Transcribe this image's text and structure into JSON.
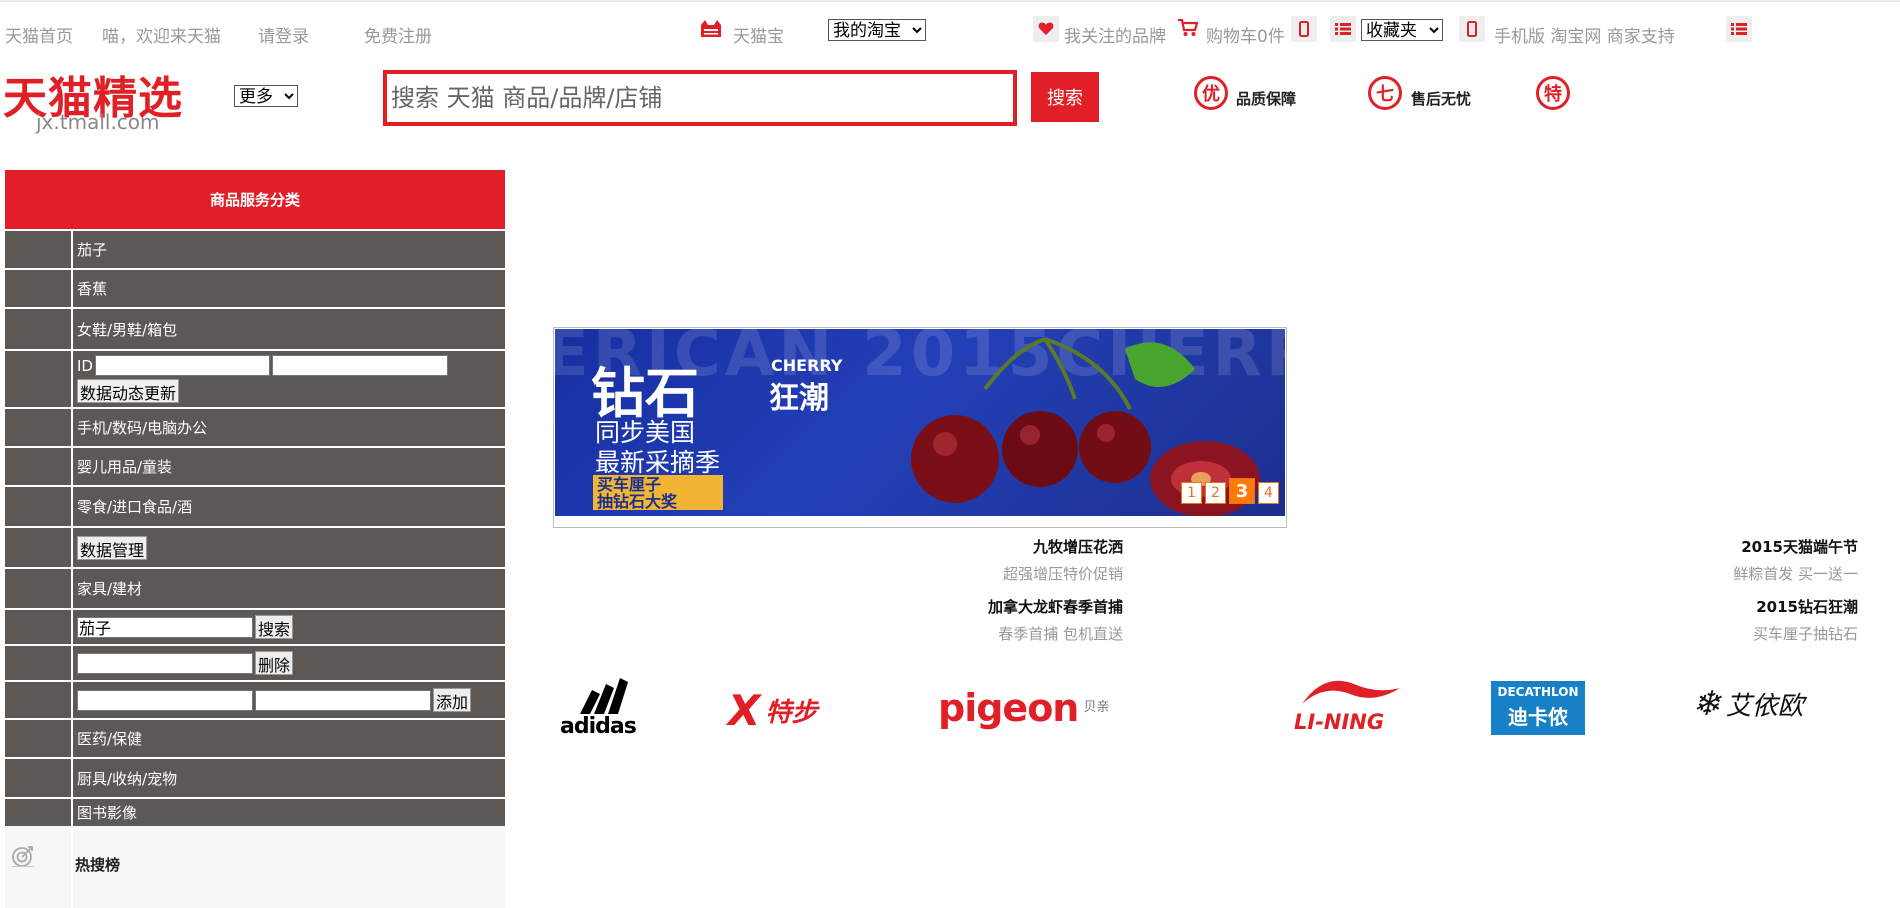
{
  "topbar": {
    "home": "天猫首页",
    "welcome": "喵，欢迎来天猫",
    "login": "请登录",
    "register": "免费注册",
    "tmall_treasure": "天猫宝",
    "my_taobao": "我的淘宝",
    "followed_brands": "我关注的品牌",
    "cart": "购物车0件",
    "favorites": "收藏夹",
    "mobile_links": "手机版 淘宝网 商家支持"
  },
  "header": {
    "logo_main": "天猫精选",
    "logo_sub": "jx.tmall.com",
    "more": "更多",
    "search_placeholder": "搜索 天猫 商品/品牌/店铺",
    "search_button": "搜索",
    "badges": [
      {
        "icon_text": "优",
        "label": "品质保障"
      },
      {
        "icon_text": "七",
        "label": "售后无忧"
      },
      {
        "icon_text": "特",
        "label": ""
      }
    ]
  },
  "sidebar": {
    "title": "商品服务分类",
    "items": {
      "qiezi": "茄子",
      "banana": "香蕉",
      "shoes": "女鞋/男鞋/箱包",
      "id_label": "ID",
      "dynamic_update": "数据动态更新",
      "digital": "手机/数码/电脑办公",
      "baby": "婴儿用品/童装",
      "snacks": "零食/进口食品/酒",
      "data_manage": "数据管理",
      "furniture": "家具/建材",
      "search_value": "茄子",
      "search_button": "搜索",
      "delete_button": "删除",
      "add_button": "添加",
      "medicine": "医药/保健",
      "kitchen": "厨具/收纳/宠物",
      "books": "图书影像",
      "hot": "热搜榜"
    }
  },
  "banner": {
    "bg_text": "ERICAN 2015CHERRY",
    "title": "钻石",
    "cherry": "CHERRY",
    "craze": "狂潮",
    "line1": "同步美国",
    "line2": "最新采摘季",
    "promo_line1": "买车厘子",
    "promo_line2": "抽钻石大奖",
    "pages": [
      "1",
      "2",
      "3",
      "4"
    ],
    "active_page": "3"
  },
  "promos": [
    {
      "title": "九牧增压花洒",
      "subtitle": "超强增压特价促销"
    },
    {
      "title": "加拿大龙虾春季首捕",
      "subtitle": "春季首捕 包机直送"
    },
    {
      "title": "2015天猫端午节",
      "subtitle": "鲜粽首发 买一送一"
    },
    {
      "title": "2015钻石狂潮",
      "subtitle": "买车厘子抽钻石"
    }
  ],
  "brands": {
    "adidas": "adidas",
    "xtep": "特步",
    "pigeon": "pigeon",
    "pigeon_cn": "贝亲",
    "lining": "LI-NING",
    "decathlon": "DECATHLON",
    "decathlon_cn": "迪卡侬",
    "aiyiou": "艾依欧"
  },
  "colors": {
    "brand_red": "#e01f27",
    "sidebar_gray": "#5c5855",
    "pager_orange": "#ff7a00",
    "banner_blue": "#1b2f8e"
  }
}
